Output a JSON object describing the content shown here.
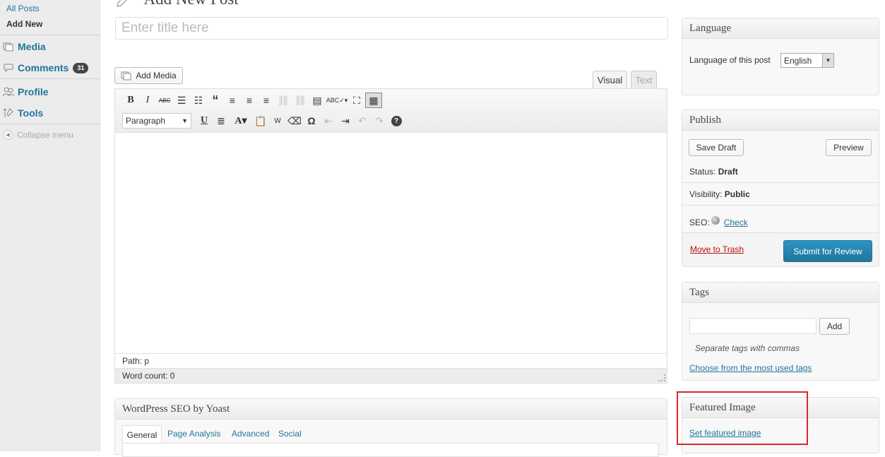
{
  "sidebar": {
    "submenu": [
      "All Posts",
      "Add New"
    ],
    "media": "Media",
    "comments": "Comments",
    "comments_count": "31",
    "profile": "Profile",
    "tools": "Tools",
    "collapse": "Collapse menu"
  },
  "page": {
    "title": "Add New Post"
  },
  "title_input": {
    "placeholder": "Enter title here"
  },
  "editor": {
    "add_media": "Add Media",
    "tab_visual": "Visual",
    "tab_text": "Text",
    "format": "Paragraph",
    "path": "Path: p",
    "word_count": "Word count: 0"
  },
  "language_box": {
    "title": "Language",
    "label": "Language of this post",
    "value": "English"
  },
  "publish_box": {
    "title": "Publish",
    "save_draft": "Save Draft",
    "preview": "Preview",
    "status_label": "Status: ",
    "status_value": "Draft",
    "visibility_label": "Visibility: ",
    "visibility_value": "Public",
    "seo_label": "SEO: ",
    "seo_check": "Check",
    "trash": "Move to Trash",
    "submit": "Submit for Review"
  },
  "tags_box": {
    "title": "Tags",
    "add": "Add",
    "hint": "Separate tags with commas",
    "choose": "Choose from the most used tags"
  },
  "featured_box": {
    "title": "Featured Image",
    "set": "Set featured image"
  },
  "yoast_box": {
    "title": "WordPress SEO by Yoast",
    "tabs": [
      "General",
      "Page Analysis",
      "Advanced",
      "Social"
    ]
  },
  "colors": {
    "link": "#21759b",
    "highlight": "#d9282b",
    "primary_button": "#21759b"
  }
}
